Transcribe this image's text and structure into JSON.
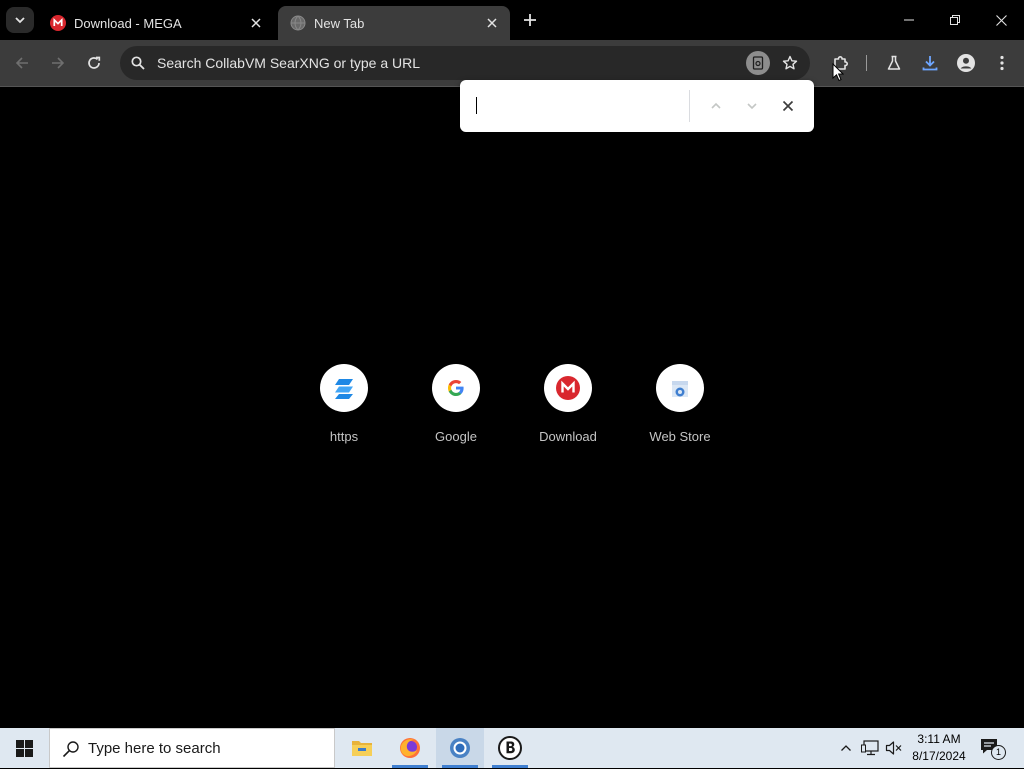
{
  "browser": {
    "tabs": [
      {
        "title": "Download - MEGA",
        "active": false
      },
      {
        "title": "New Tab",
        "active": true
      }
    ],
    "omnibox": {
      "placeholder": "Search CollabVM SearXNG or type a URL"
    },
    "find_bar": {
      "query": ""
    }
  },
  "new_tab_page": {
    "shortcuts": [
      {
        "label": "https",
        "icon": "blue-stripe-logo-icon"
      },
      {
        "label": "Google",
        "icon": "google-g-icon"
      },
      {
        "label": "Download",
        "icon": "mega-logo-icon"
      },
      {
        "label": "Web Store",
        "icon": "web-store-icon"
      }
    ]
  },
  "taskbar": {
    "search_placeholder": "Type here to search",
    "apps": [
      "file-explorer-icon",
      "firefox-icon",
      "chrome-icon",
      "brave-b-icon"
    ],
    "clock": {
      "time": "3:11 AM",
      "date": "8/17/2024"
    },
    "notification_count": "1"
  },
  "colors": {
    "accent": "#3f7fd0",
    "mega_red": "#d9272e",
    "toolbar": "#3c3c3c",
    "taskbar": "#dfe8f1"
  }
}
